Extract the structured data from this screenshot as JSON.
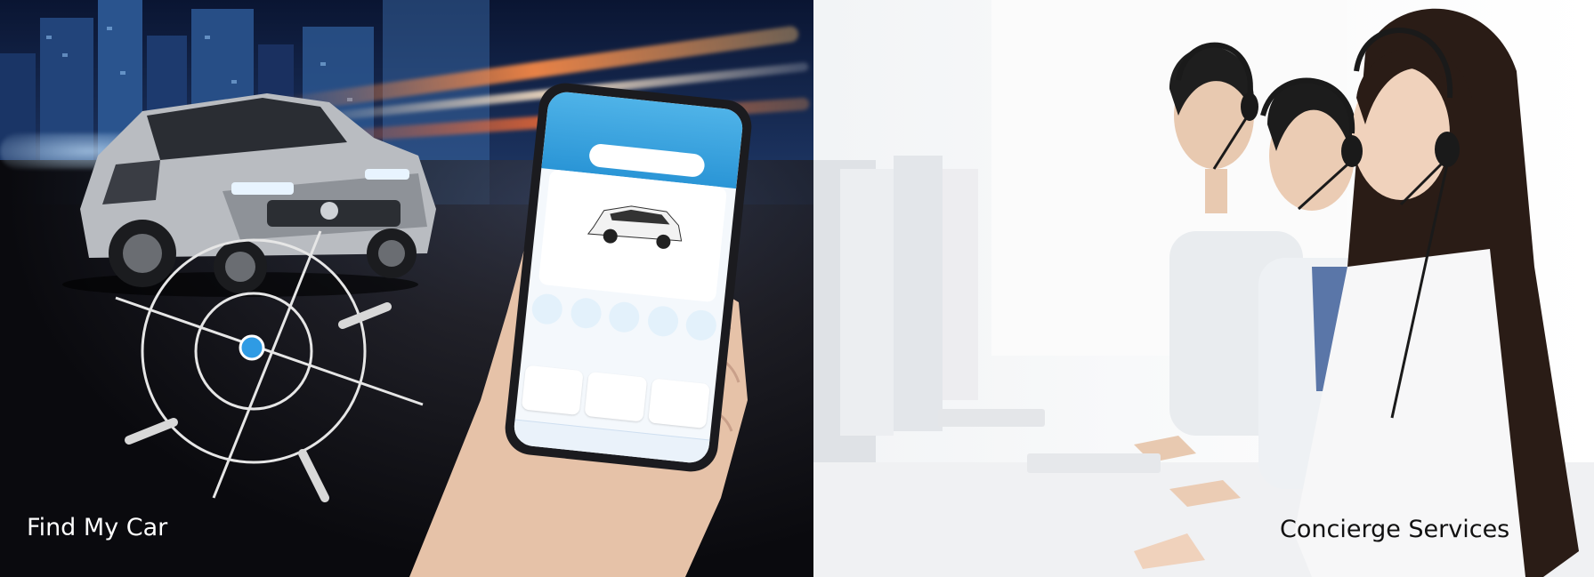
{
  "left_panel": {
    "caption": "Find My Car"
  },
  "right_panel": {
    "caption": "Concierge Services"
  },
  "colors": {
    "location_dot": "#2f9be4",
    "target_lines": "#e6e6e6",
    "app_blue": "#2a95d6"
  }
}
